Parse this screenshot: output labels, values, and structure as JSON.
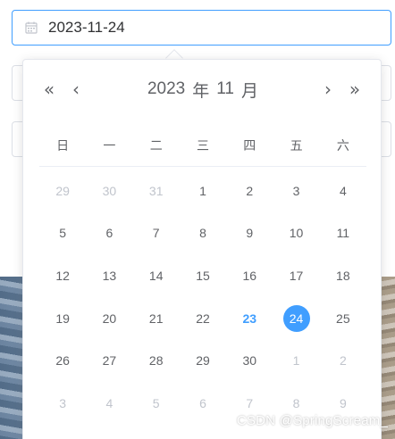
{
  "date_input": {
    "value": "2023-11-24"
  },
  "picker": {
    "nav": {
      "prev_year": "«",
      "prev_month": "‹",
      "next_month": "›",
      "next_year": "»"
    },
    "year": "2023",
    "year_unit": "年",
    "month": "11",
    "month_unit": "月",
    "weekdays": [
      "日",
      "一",
      "二",
      "三",
      "四",
      "五",
      "六"
    ],
    "weeks": [
      [
        "29",
        "30",
        "31",
        "1",
        "2",
        "3",
        "4"
      ],
      [
        "5",
        "6",
        "7",
        "8",
        "9",
        "10",
        "11"
      ],
      [
        "12",
        "13",
        "14",
        "15",
        "16",
        "17",
        "18"
      ],
      [
        "19",
        "20",
        "21",
        "22",
        "23",
        "24",
        "25"
      ],
      [
        "26",
        "27",
        "28",
        "29",
        "30",
        "1",
        "2"
      ],
      [
        "3",
        "4",
        "5",
        "6",
        "7",
        "8",
        "9"
      ]
    ],
    "today": "23",
    "selected": "24"
  },
  "colors": {
    "accent": "#409eff",
    "muted": "#c0c4cc",
    "text": "#606266"
  },
  "watermark": "CSDN @SpringScream_"
}
